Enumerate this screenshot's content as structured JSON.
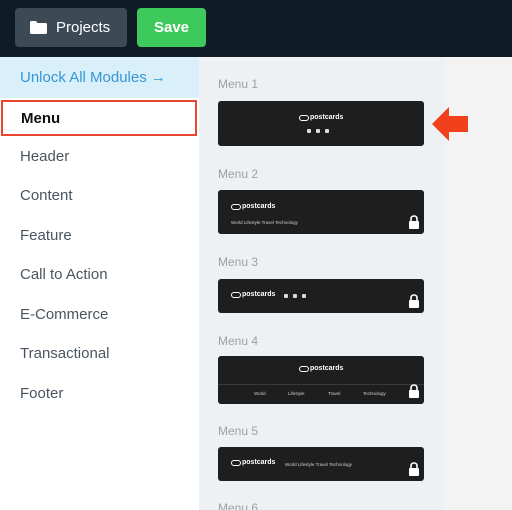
{
  "topbar": {
    "projects_label": "Projects",
    "save_label": "Save"
  },
  "sidebar": {
    "unlock_label": "Unlock All Modules →",
    "items": [
      {
        "label": "Menu",
        "active": true
      },
      {
        "label": "Header"
      },
      {
        "label": "Content"
      },
      {
        "label": "Feature"
      },
      {
        "label": "Call to Action"
      },
      {
        "label": "E-Commerce"
      },
      {
        "label": "Transactional"
      },
      {
        "label": "Footer"
      }
    ]
  },
  "panel": {
    "brand": "postcards",
    "menus": [
      {
        "label": "Menu 1",
        "locked": false
      },
      {
        "label": "Menu 2",
        "locked": true,
        "nav": "World   Lifestyle   Travel   Technology"
      },
      {
        "label": "Menu 3",
        "locked": true
      },
      {
        "label": "Menu 4",
        "locked": true,
        "nav": [
          "World",
          "Lifestyle",
          "Travel",
          "Technology"
        ]
      },
      {
        "label": "Menu 5",
        "locked": true,
        "nav": "World   Lifestyle   Travel   Technology"
      },
      {
        "label": "Menu 6"
      }
    ]
  },
  "colors": {
    "topbar_bg": "#0f1c26",
    "save_green": "#3ec95d",
    "accent_red": "#e8462d",
    "link_blue": "#3597d3"
  }
}
